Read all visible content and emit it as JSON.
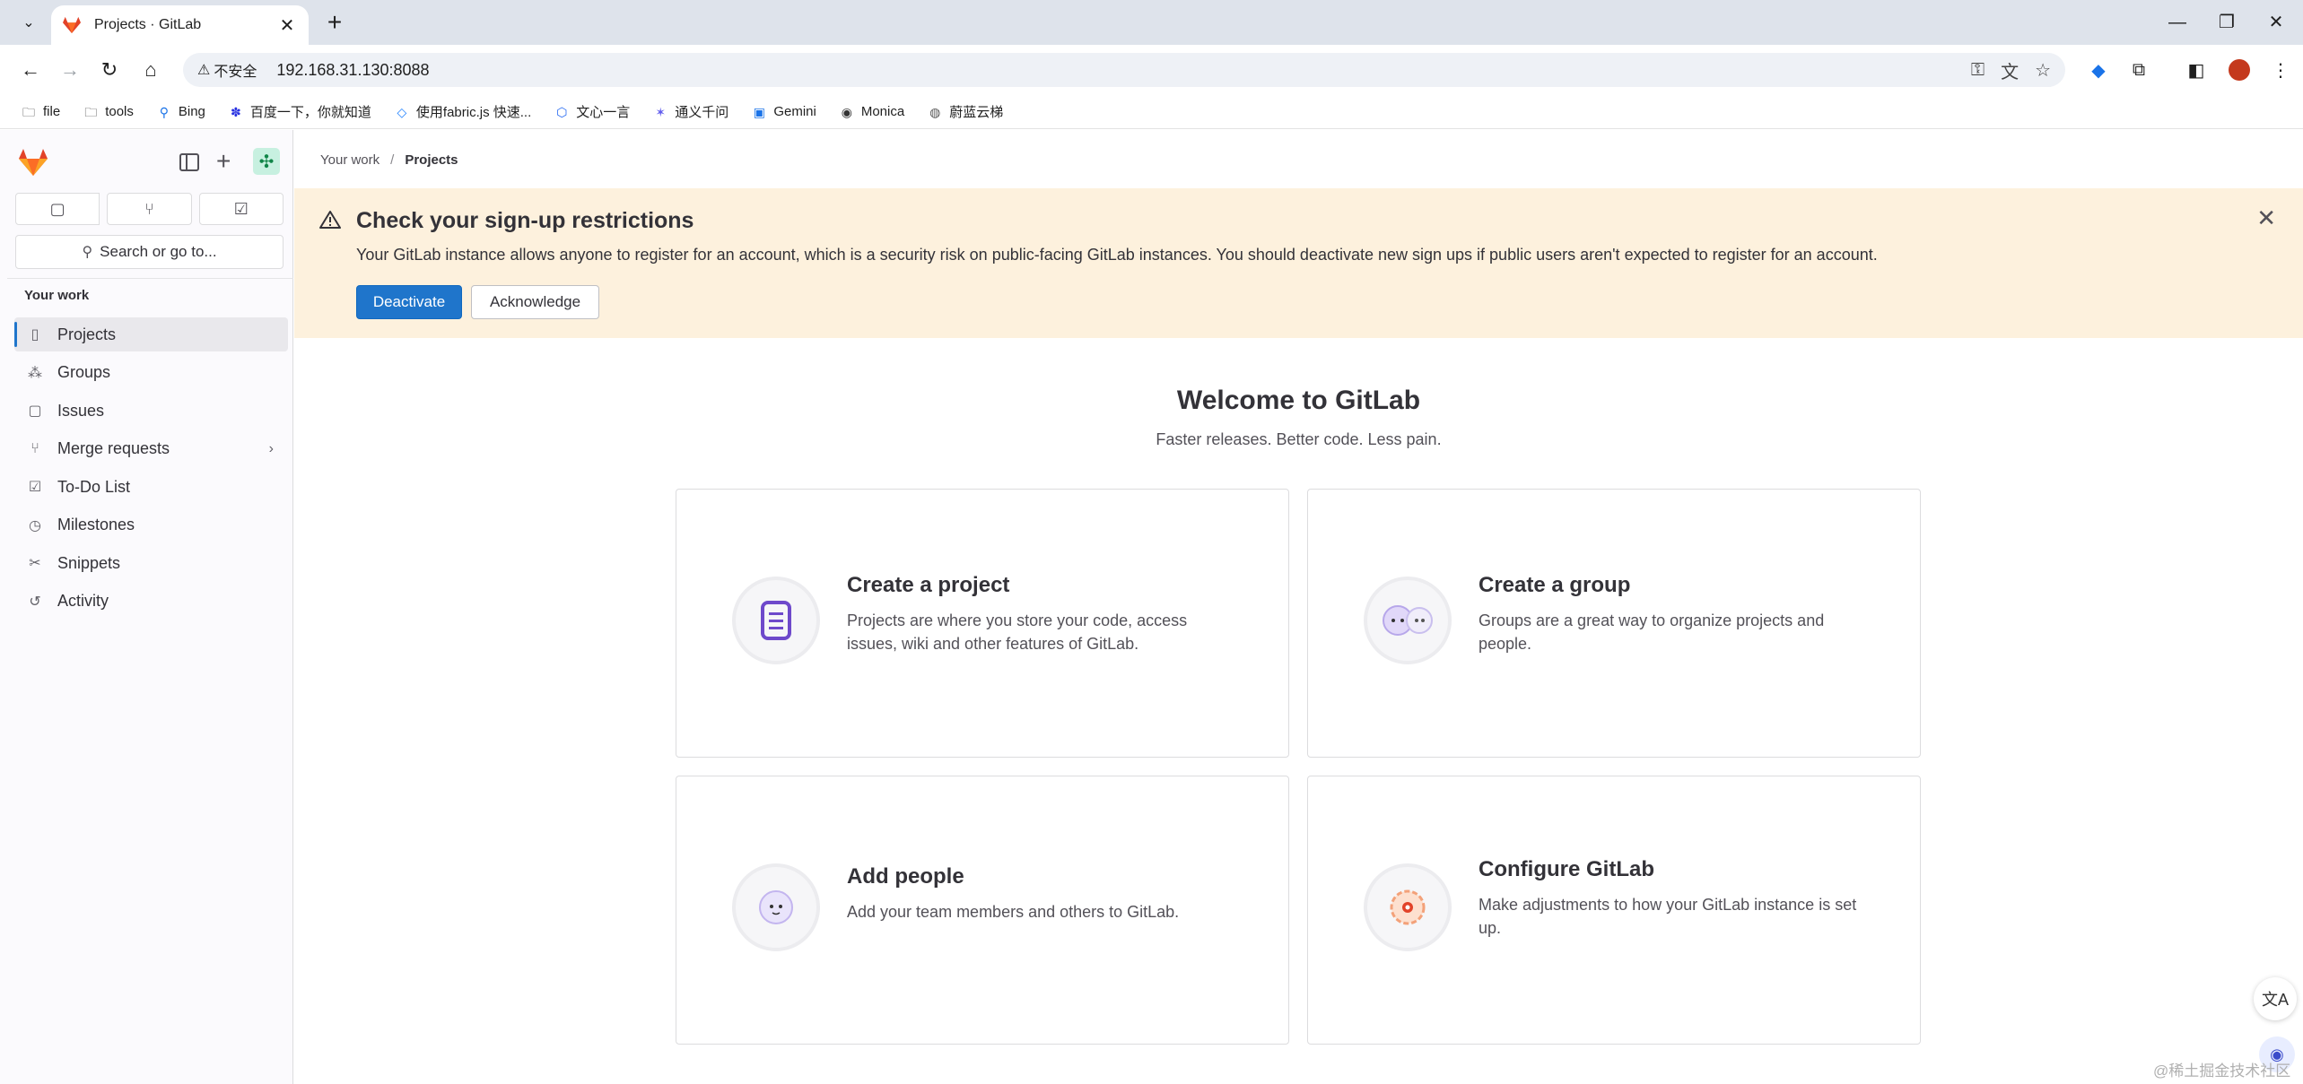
{
  "browser": {
    "tab_title": "Projects · GitLab",
    "tab_close": "✕",
    "new_tab": "+",
    "security_label": "不安全",
    "url": "192.168.31.130:8088",
    "window_controls": [
      "—",
      "❐",
      "✕"
    ],
    "bookmarks": [
      {
        "label": "file",
        "icon": "folder-icon"
      },
      {
        "label": "tools",
        "icon": "folder-icon"
      },
      {
        "label": "Bing",
        "icon": "search-icon"
      },
      {
        "label": "百度一下，你就知道",
        "icon": "baidu-icon"
      },
      {
        "label": "使用fabric.js 快速...",
        "icon": "juejin-icon"
      },
      {
        "label": "文心一言",
        "icon": "wenxin-icon"
      },
      {
        "label": "通义千问",
        "icon": "tongyi-icon"
      },
      {
        "label": "Gemini",
        "icon": "gemini-icon"
      },
      {
        "label": "Monica",
        "icon": "monica-icon"
      },
      {
        "label": "蔚蓝云梯",
        "icon": "globe-icon"
      }
    ]
  },
  "sidebar": {
    "search_placeholder": "Search or go to...",
    "section_title": "Your work",
    "items": [
      {
        "label": "Projects",
        "icon": "project-icon",
        "active": true
      },
      {
        "label": "Groups",
        "icon": "group-icon"
      },
      {
        "label": "Issues",
        "icon": "issues-icon"
      },
      {
        "label": "Merge requests",
        "icon": "merge-request-icon",
        "has_submenu": true
      },
      {
        "label": "To-Do List",
        "icon": "todo-icon"
      },
      {
        "label": "Milestones",
        "icon": "milestone-icon"
      },
      {
        "label": "Snippets",
        "icon": "snippet-icon"
      },
      {
        "label": "Activity",
        "icon": "history-icon"
      }
    ]
  },
  "breadcrumb": {
    "parent": "Your work",
    "separator": "/",
    "current": "Projects"
  },
  "alert": {
    "title": "Check your sign-up restrictions",
    "body": "Your GitLab instance allows anyone to register for an account, which is a security risk on public-facing GitLab instances. You should deactivate new sign ups if public users aren't expected to register for an account.",
    "primary_label": "Deactivate",
    "secondary_label": "Acknowledge",
    "close": "✕"
  },
  "welcome": {
    "title": "Welcome to GitLab",
    "tagline": "Faster releases. Better code. Less pain.",
    "cards": [
      {
        "title": "Create a project",
        "description": "Projects are where you store your code, access issues, wiki and other features of GitLab.",
        "icon": "project-illustration-icon"
      },
      {
        "title": "Create a group",
        "description": "Groups are a great way to organize projects and people.",
        "icon": "group-illustration-icon"
      },
      {
        "title": "Add people",
        "description": "Add your team members and others to GitLab.",
        "icon": "people-illustration-icon"
      },
      {
        "title": "Configure GitLab",
        "description": "Make adjustments to how your GitLab instance is set up.",
        "icon": "settings-illustration-icon"
      }
    ]
  },
  "watermark": "@稀土掘金技术社区",
  "colors": {
    "primary": "#1f75cb",
    "alert_bg": "#fdf1dd",
    "gitlab_orange": "#e24329",
    "tab_bar": "#dee3eb"
  }
}
